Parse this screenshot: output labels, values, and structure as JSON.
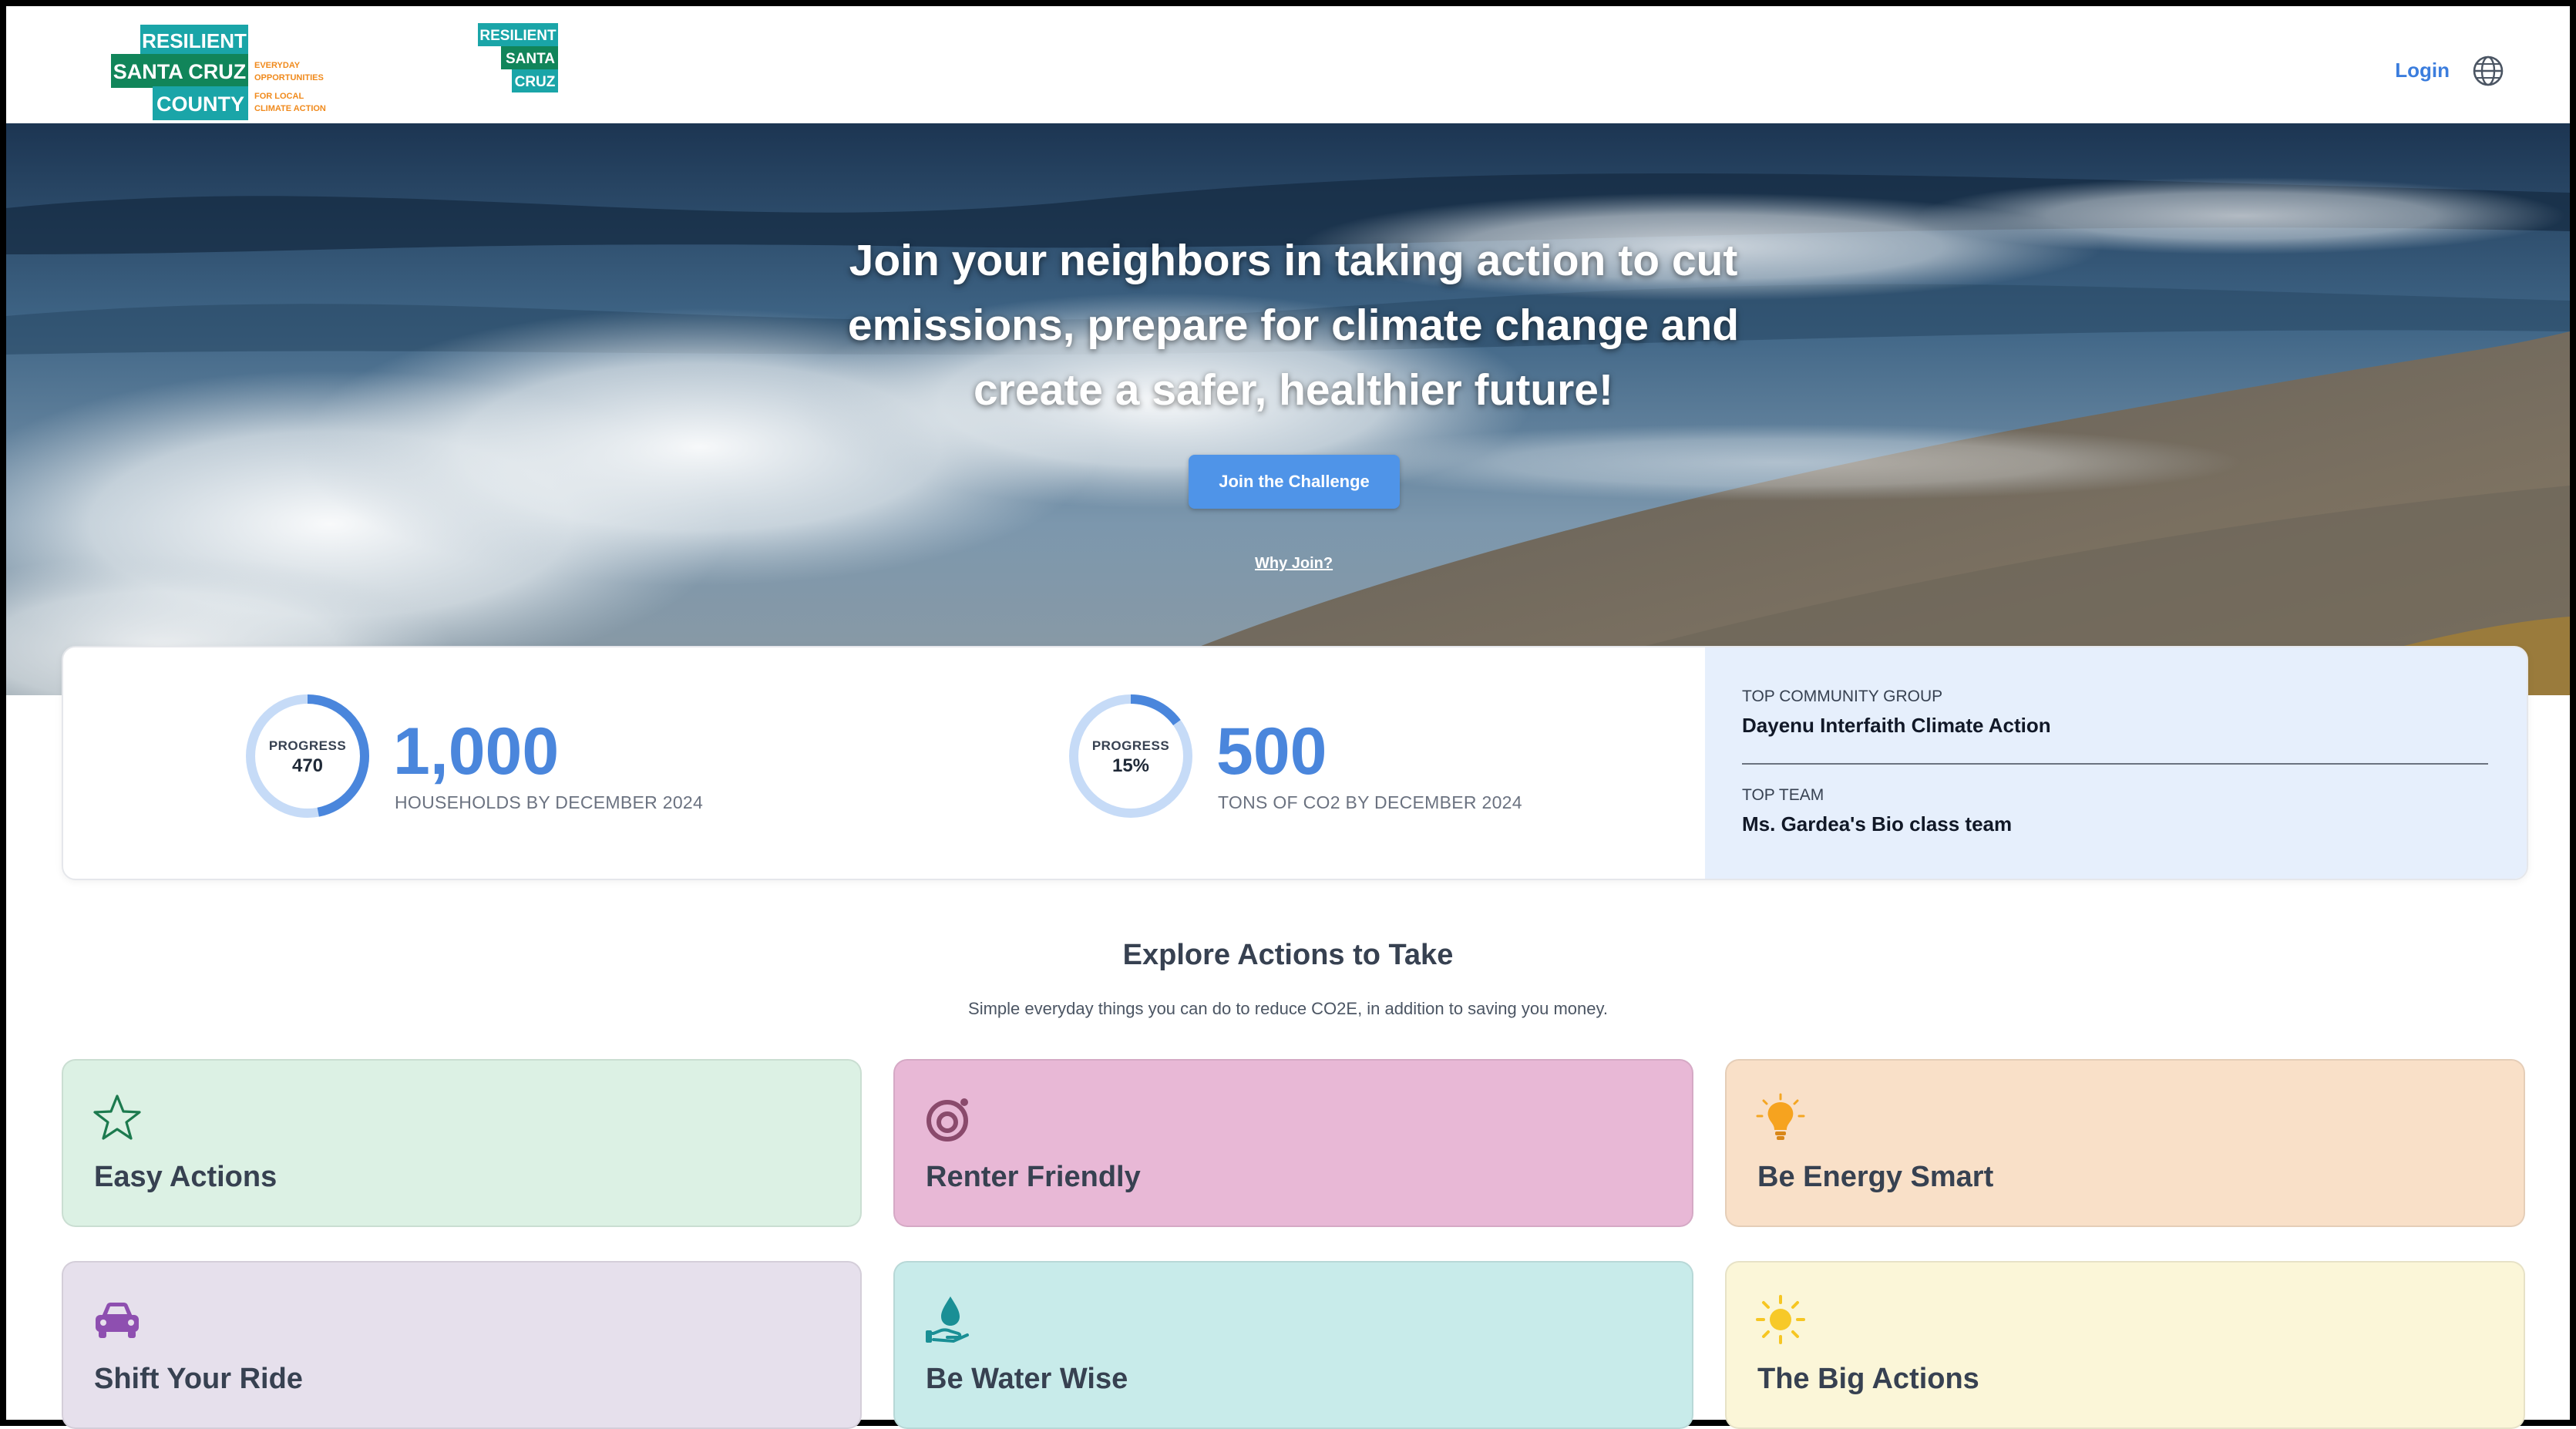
{
  "header": {
    "logo_main": {
      "line1": "RESILIENT",
      "line2": "SANTA CRUZ",
      "line3": "COUNTY",
      "tagline": [
        "EVERYDAY",
        "OPPORTUNITIES",
        "FOR LOCAL",
        "CLIMATE ACTION"
      ]
    },
    "logo_secondary": {
      "line1": "RESILIENT",
      "line2": "SANTA",
      "line3": "CRUZ"
    },
    "login_label": "Login",
    "globe_icon": "globe-icon"
  },
  "hero": {
    "title": "Join your neighbors in taking action to cut emissions, prepare for climate change and create a safer, healthier future!",
    "cta_label": "Join the Challenge",
    "why_join_label": "Why Join?"
  },
  "stats": {
    "households": {
      "ring_label": "PROGRESS",
      "ring_value": "470",
      "progress_fraction": 0.47,
      "goal_number": "1,000",
      "goal_label": "HOUSEHOLDS BY DECEMBER 2024"
    },
    "co2": {
      "ring_label": "PROGRESS",
      "ring_value": "15%",
      "progress_fraction": 0.15,
      "goal_number": "500",
      "goal_label": "TONS OF CO2 BY DECEMBER 2024"
    },
    "leaders": {
      "group_heading": "TOP COMMUNITY GROUP",
      "group_name": "Dayenu Interfaith Climate Action",
      "team_heading": "TOP TEAM",
      "team_name": "Ms. Gardea's Bio class team"
    }
  },
  "explore": {
    "title": "Explore Actions to Take",
    "subtitle": "Simple everyday things you can do to reduce CO2E, in addition to saving you money.",
    "categories": [
      {
        "label": "Easy Actions",
        "icon": "star-icon",
        "color": "#dcf1e4"
      },
      {
        "label": "Renter Friendly",
        "icon": "spiral-icon",
        "color": "#e8b8d6"
      },
      {
        "label": "Be Energy Smart",
        "icon": "lightbulb-icon",
        "color": "#f9e0c8"
      },
      {
        "label": "Shift Your Ride",
        "icon": "car-icon",
        "color": "#e6e0ec"
      },
      {
        "label": "Be Water Wise",
        "icon": "water-hand-icon",
        "color": "#c8ebea"
      },
      {
        "label": "The Big Actions",
        "icon": "sun-icon",
        "color": "#fbf6d8"
      }
    ]
  },
  "colors": {
    "accent": "#4a86dc",
    "button": "#4f94e8",
    "leaders_bg": "#e6effc"
  }
}
